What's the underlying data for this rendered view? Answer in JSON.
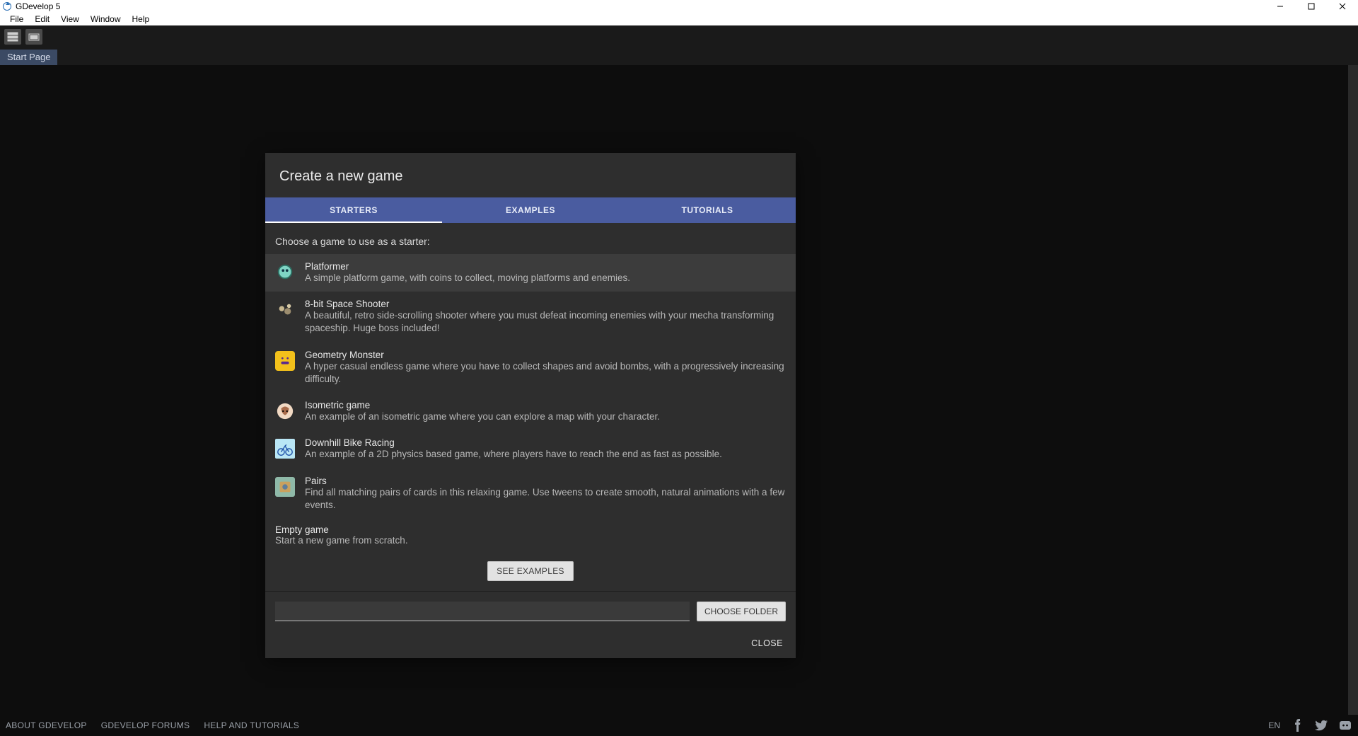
{
  "window": {
    "title": "GDevelop 5"
  },
  "menu": {
    "items": [
      "File",
      "Edit",
      "View",
      "Window",
      "Help"
    ]
  },
  "tab": {
    "label": "Start Page"
  },
  "dialog": {
    "title": "Create a new game",
    "tabs": {
      "starters": "STARTERS",
      "examples": "EXAMPLES",
      "tutorials": "TUTORIALS"
    },
    "prompt": "Choose a game to use as a starter:",
    "starters": [
      {
        "title": "Platformer",
        "desc": "A simple platform game, with coins to collect, moving platforms and enemies."
      },
      {
        "title": "8-bit Space Shooter",
        "desc": "A beautiful, retro side-scrolling shooter where you must defeat incoming enemies with your mecha transforming spaceship. Huge boss included!"
      },
      {
        "title": "Geometry Monster",
        "desc": "A hyper casual endless game where you have to collect shapes and avoid bombs, with a progressively increasing difficulty."
      },
      {
        "title": "Isometric game",
        "desc": "An example of an isometric game where you can explore a map with your character."
      },
      {
        "title": "Downhill Bike Racing",
        "desc": "An example of a 2D physics based game, where players have to reach the end as fast as possible."
      },
      {
        "title": "Pairs",
        "desc": "Find all matching pairs of cards in this relaxing game. Use tweens to create smooth, natural animations with a few events."
      }
    ],
    "empty": {
      "title": "Empty game",
      "desc": "Start a new game from scratch."
    },
    "see_examples": "SEE EXAMPLES",
    "choose_folder": "CHOOSE FOLDER",
    "folder_value": "",
    "close": "CLOSE"
  },
  "footer": {
    "about": "ABOUT GDEVELOP",
    "forums": "GDEVELOP FORUMS",
    "help": "HELP AND TUTORIALS",
    "lang": "EN"
  }
}
